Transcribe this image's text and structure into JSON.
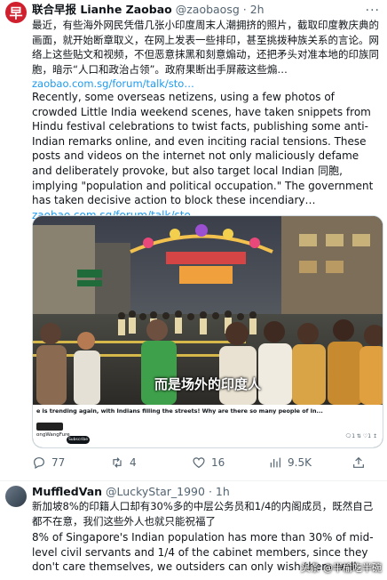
{
  "tweet1": {
    "name": "联合早报 Lianhe Zaobao",
    "handle": "@zaobaosg",
    "time": "· 2h",
    "avatar_text": "早",
    "text_zh": "最近，有些海外网民凭借几张小印度周末人潮拥挤的照片，截取印度教庆典的画面，就开始断章取义，在网上发表一些排印，甚至挑拨种族关系的言论。网络上这些贴文和视频，不但恶意抹黑和刻意煽动，还把矛头对准本地的印族同胞，暗示“人口和政治占领”。政府果断出手屏蔽这些煽…",
    "link_zh": "zaobao.com.sg/forum/talk/sto…",
    "text_en": "Recently, some overseas netizens, using a few photos of crowded Little India weekend scenes, have taken snippets from Hindu festival celebrations to twist facts, publishing some anti-Indian remarks online, and even inciting racial tensions. These posts and videos on the internet not only maliciously defame and deliberately provoke, but also target local Indian 同胞, implying \"population and political occupation.\" The government has taken decisive action to block these incendiary…",
    "link_en": "zaobao.com.sg/forum/talk/sto…",
    "media": {
      "subtitle": "而是场外的印度人",
      "strip_text": "e is trending again, with Indians filling the streets! Why are there so many people of In...",
      "strip_account": "ongWangFure",
      "strip_subscribe": "Subscribe",
      "strip_stats": "🗨1  ⇅  ♡1  ↥"
    },
    "actions": {
      "replies": "77",
      "retweets": "4",
      "likes": "16",
      "views": "9.5K"
    }
  },
  "tweet2": {
    "name": "MuffledVan",
    "handle": "@LuckyStar_1990",
    "time": "· 1h",
    "text_zh": "新加坡8%的印籍人口却有30%多的中层公务员和1/4的内阁成员，既然自己都不在意，我们这些外人也就只能祝福了",
    "text_en": "8% of Singapore's Indian population has more than 30% of mid-level civil servants and 1/4 of the cabinet members, since they don't care themselves, we outsiders can only wish them well"
  },
  "watermark": "头条 @半榆吃半碗",
  "colors": {
    "link": "#1d9bf0",
    "avatar_red": "#d01f2d",
    "muted": "#536471"
  }
}
